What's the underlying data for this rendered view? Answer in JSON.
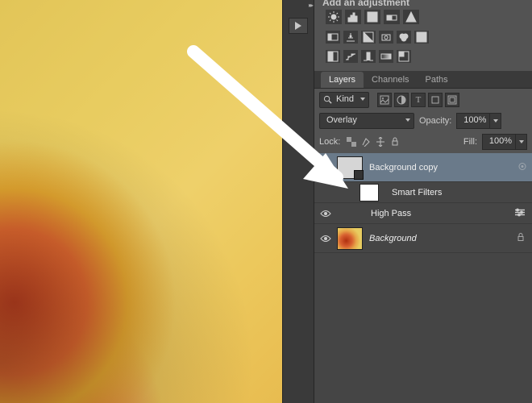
{
  "panel": {
    "headline": "Add an adjustment",
    "tabs": [
      "Layers",
      "Channels",
      "Paths"
    ],
    "active_tab": 0,
    "kind_filter": "Kind",
    "blend_mode": "Overlay",
    "opacity": {
      "label": "Opacity:",
      "value": "100%"
    },
    "fill": {
      "label": "Fill:",
      "value": "100%"
    },
    "lock_label": "Lock:"
  },
  "layers": [
    {
      "name": "Background copy",
      "selected": true,
      "smart": true,
      "visible": false
    },
    {
      "name": "Smart Filters",
      "type": "smart-filter-group"
    },
    {
      "name": "High Pass",
      "type": "filter",
      "visible": true
    },
    {
      "name": "Background",
      "locked": true,
      "italic": true,
      "visible": true
    }
  ]
}
